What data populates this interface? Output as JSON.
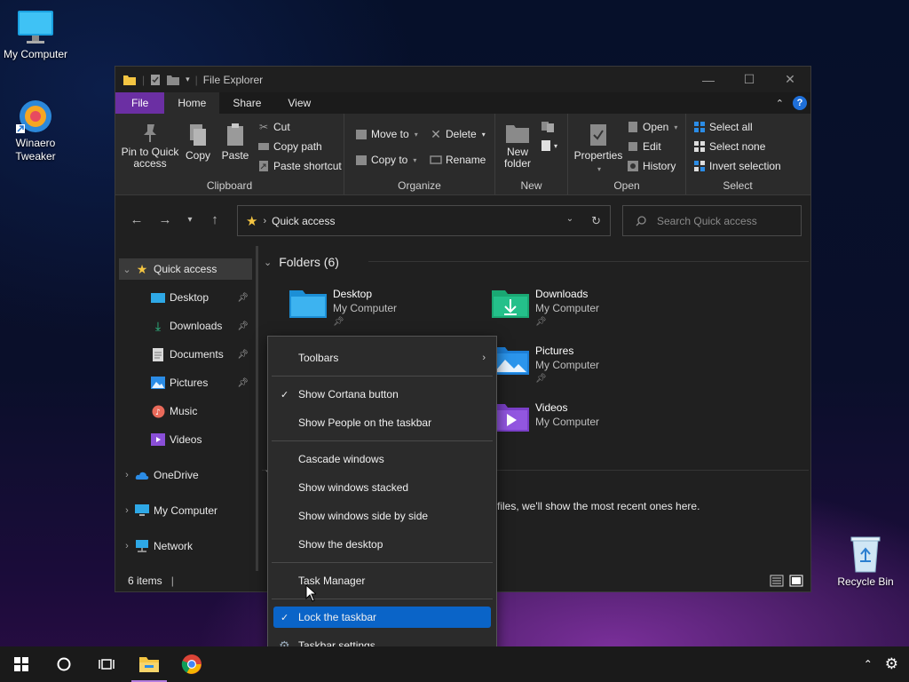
{
  "desktop": {
    "icons": [
      {
        "label": "My Computer"
      },
      {
        "label": "Winaero Tweaker"
      },
      {
        "label": "Recycle Bin"
      }
    ]
  },
  "window": {
    "title": "File Explorer",
    "tabs": [
      "File",
      "Home",
      "Share",
      "View"
    ],
    "ribbon": {
      "clipboard": {
        "pin": "Pin to Quick access",
        "copy": "Copy",
        "paste": "Paste",
        "cut": "Cut",
        "copy_path": "Copy path",
        "paste_shortcut": "Paste shortcut",
        "label": "Clipboard"
      },
      "organize": {
        "move_to": "Move to",
        "copy_to": "Copy to",
        "delete": "Delete",
        "rename": "Rename",
        "label": "Organize"
      },
      "new": {
        "new_folder": "New folder",
        "label": "New"
      },
      "open": {
        "properties": "Properties",
        "open": "Open",
        "edit": "Edit",
        "history": "History",
        "label": "Open"
      },
      "select": {
        "select_all": "Select all",
        "select_none": "Select none",
        "invert": "Invert selection",
        "label": "Select"
      }
    },
    "address": {
      "crumb": "Quick access"
    },
    "search": {
      "placeholder": "Search Quick access"
    },
    "nav": [
      {
        "label": "Quick access"
      },
      {
        "label": "Desktop"
      },
      {
        "label": "Downloads"
      },
      {
        "label": "Documents"
      },
      {
        "label": "Pictures"
      },
      {
        "label": "Music"
      },
      {
        "label": "Videos"
      },
      {
        "label": "OneDrive"
      },
      {
        "label": "My Computer"
      },
      {
        "label": "Network"
      }
    ],
    "content": {
      "section": "Folders (6)",
      "folders": [
        {
          "name": "Desktop",
          "location": "My Computer"
        },
        {
          "name": "Downloads",
          "location": "My Computer"
        },
        {
          "name": "Pictures",
          "location": "My Computer"
        },
        {
          "name": "Videos",
          "location": "My Computer"
        }
      ],
      "recent_message": "files, we'll show the most recent ones here."
    },
    "status": {
      "items": "6 items"
    }
  },
  "context_menu": {
    "items": [
      {
        "label": "Toolbars"
      },
      {
        "label": "Show Cortana button"
      },
      {
        "label": "Show People on the taskbar"
      },
      {
        "label": "Cascade windows"
      },
      {
        "label": "Show windows stacked"
      },
      {
        "label": "Show windows side by side"
      },
      {
        "label": "Show the desktop"
      },
      {
        "label": "Task Manager"
      },
      {
        "label": "Lock the taskbar"
      },
      {
        "label": "Taskbar settings"
      }
    ]
  },
  "colors": {
    "accent": "#0a64c8",
    "file_tab": "#6b2fa3"
  }
}
